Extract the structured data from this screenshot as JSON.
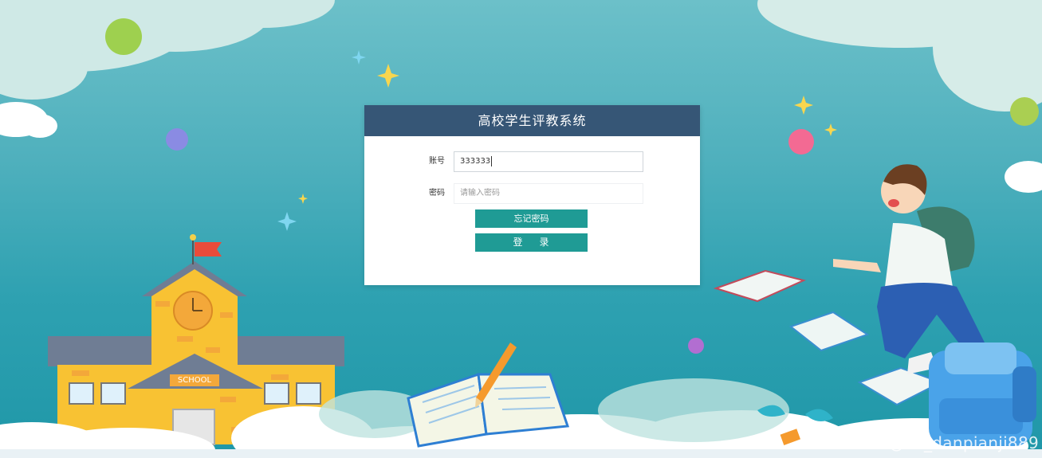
{
  "app": {
    "title": "高校学生评教系统"
  },
  "form": {
    "account_label": "账号",
    "account_value": "333333",
    "password_label": "密码",
    "password_placeholder": "请输入密码"
  },
  "buttons": {
    "forgot_label": "忘记密码",
    "login_char_1": "登",
    "login_char_2": "录"
  },
  "scene": {
    "school_sign": "SCHOOL"
  },
  "watermark": "CSDN @vx_danpianji889",
  "colors": {
    "header": "#365676",
    "button": "#1f9b95",
    "background_top": "#6cc0c9",
    "background_bottom": "#1f97a8"
  },
  "icons": [
    "sparkle-icon",
    "clock-icon",
    "flag-icon",
    "pencil-icon",
    "book-icon",
    "backpack-icon"
  ]
}
